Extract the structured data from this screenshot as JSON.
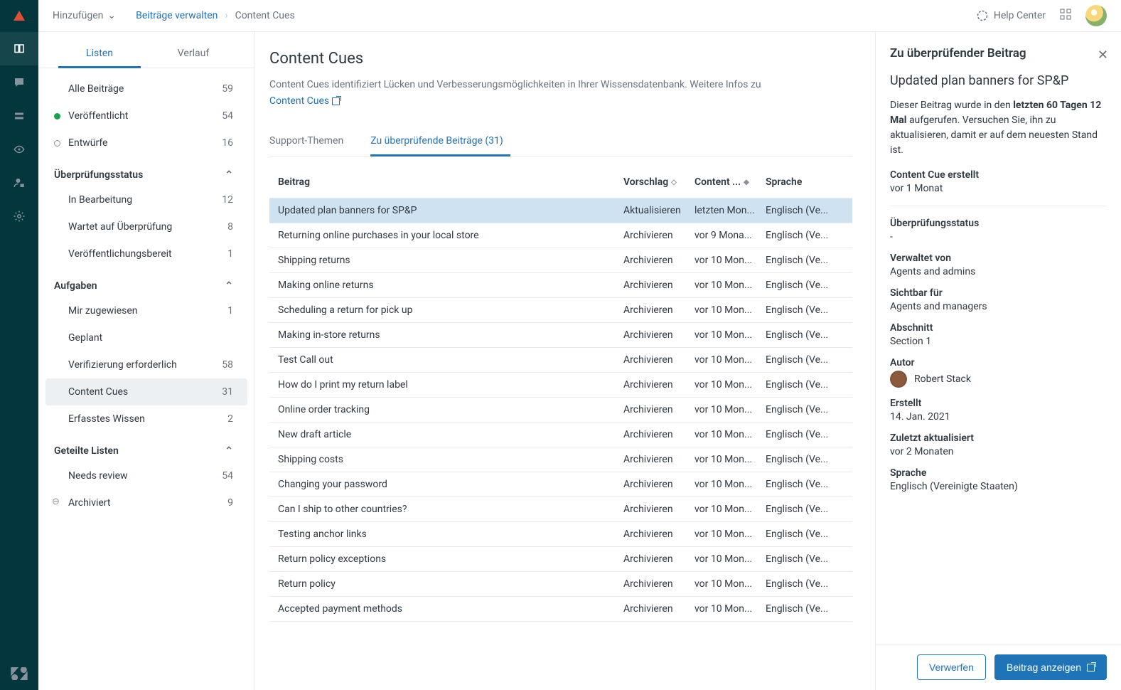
{
  "topbar": {
    "add_label": "Hinzufügen",
    "crumb_link": "Beiträge verwalten",
    "crumb_current": "Content Cues",
    "help_label": "Help Center"
  },
  "sidebar": {
    "tabs": {
      "listen": "Listen",
      "verlauf": "Verlauf"
    },
    "primary": [
      {
        "label": "Alle Beiträge",
        "count": "59",
        "dot": ""
      },
      {
        "label": "Veröffentlicht",
        "count": "54",
        "dot": "green"
      },
      {
        "label": "Entwürfe",
        "count": "16",
        "dot": "outline"
      }
    ],
    "groups": [
      {
        "heading": "Überprüfungsstatus",
        "items": [
          {
            "label": "In Bearbeitung",
            "count": "12"
          },
          {
            "label": "Wartet auf Überprüfung",
            "count": "8"
          },
          {
            "label": "Veröffentlichungsbereit",
            "count": "1"
          }
        ]
      },
      {
        "heading": "Aufgaben",
        "items": [
          {
            "label": "Mir zugewiesen",
            "count": "1"
          },
          {
            "label": "Geplant",
            "count": ""
          },
          {
            "label": "Verifizierung erforderlich",
            "count": "58"
          },
          {
            "label": "Content Cues",
            "count": "31",
            "selected": true
          },
          {
            "label": "Erfasstes Wissen",
            "count": "2"
          }
        ]
      },
      {
        "heading": "Geteilte Listen",
        "items": [
          {
            "label": "Needs review",
            "count": "54"
          },
          {
            "label": "Archiviert",
            "count": "9",
            "dot": "archive"
          }
        ]
      }
    ]
  },
  "main": {
    "title": "Content Cues",
    "desc_prefix": "Content Cues identifiziert Lücken und Verbesserungsmöglichkeiten in Ihrer Wissensdatenbank. Weitere Infos zu",
    "desc_link": "Content Cues",
    "tabs": {
      "support": "Support-Themen",
      "review": "Zu überprüfende Beiträge (31)"
    },
    "columns": {
      "beitrag": "Beitrag",
      "vorschlag": "Vorschlag",
      "content": "Content ...",
      "sprache": "Sprache"
    },
    "rows": [
      {
        "t": "Updated plan banners for SP&P",
        "s": "Aktualisieren",
        "c": "letzten Mon...",
        "l": "Englisch (Ve...",
        "sel": true
      },
      {
        "t": "Returning online purchases in your local store",
        "s": "Archivieren",
        "c": "vor 9 Mona...",
        "l": "Englisch (Ve..."
      },
      {
        "t": "Shipping returns",
        "s": "Archivieren",
        "c": "vor 10 Mon...",
        "l": "Englisch (Ve..."
      },
      {
        "t": "Making online returns",
        "s": "Archivieren",
        "c": "vor 10 Mon...",
        "l": "Englisch (Ve..."
      },
      {
        "t": "Scheduling a return for pick up",
        "s": "Archivieren",
        "c": "vor 10 Mon...",
        "l": "Englisch (Ve..."
      },
      {
        "t": "Making in-store returns",
        "s": "Archivieren",
        "c": "vor 10 Mon...",
        "l": "Englisch (Ve..."
      },
      {
        "t": "Test Call out",
        "s": "Archivieren",
        "c": "vor 10 Mon...",
        "l": "Englisch (Ve..."
      },
      {
        "t": "How do I print my return label",
        "s": "Archivieren",
        "c": "vor 10 Mon...",
        "l": "Englisch (Ve..."
      },
      {
        "t": "Online order tracking",
        "s": "Archivieren",
        "c": "vor 10 Mon...",
        "l": "Englisch (Ve..."
      },
      {
        "t": "New draft article",
        "s": "Archivieren",
        "c": "vor 10 Mon...",
        "l": "Englisch (Ve..."
      },
      {
        "t": "Shipping costs",
        "s": "Archivieren",
        "c": "vor 10 Mon...",
        "l": "Englisch (Ve..."
      },
      {
        "t": "Changing your password",
        "s": "Archivieren",
        "c": "vor 10 Mon...",
        "l": "Englisch (Ve..."
      },
      {
        "t": "Can I ship to other countries?",
        "s": "Archivieren",
        "c": "vor 10 Mon...",
        "l": "Englisch (Ve..."
      },
      {
        "t": "Testing anchor links",
        "s": "Archivieren",
        "c": "vor 10 Mon...",
        "l": "Englisch (Ve..."
      },
      {
        "t": "Return policy exceptions",
        "s": "Archivieren",
        "c": "vor 10 Mon...",
        "l": "Englisch (Ve..."
      },
      {
        "t": "Return policy",
        "s": "Archivieren",
        "c": "vor 10 Mon...",
        "l": "Englisch (Ve..."
      },
      {
        "t": "Accepted payment methods",
        "s": "Archivieren",
        "c": "vor 10 Mon...",
        "l": "Englisch (Ve..."
      }
    ]
  },
  "detail": {
    "heading": "Zu überprüfender Beitrag",
    "title": "Updated plan banners for SP&P",
    "para_pre": "Dieser Beitrag wurde in den ",
    "para_bold": "letzten 60 Tagen 12 Mal",
    "para_post": " aufgerufen. Versuchen Sie, ihn zu aktualisieren, damit er auf dem neuesten Stand ist.",
    "cue_created_k": "Content Cue erstellt",
    "cue_created_v": "vor 1 Monat",
    "status_k": "Überprüfungsstatus",
    "status_v": "-",
    "managed_k": "Verwaltet von",
    "managed_v": "Agents and admins",
    "visible_k": "Sichtbar für",
    "visible_v": "Agents and managers",
    "section_k": "Abschnitt",
    "section_v": "Section 1",
    "author_k": "Autor",
    "author_v": "Robert Stack",
    "created_k": "Erstellt",
    "created_v": "14. Jan. 2021",
    "updated_k": "Zuletzt aktualisiert",
    "updated_v": "vor 2 Monaten",
    "lang_k": "Sprache",
    "lang_v": "Englisch (Vereinigte Staaten)",
    "discard": "Verwerfen",
    "show": "Beitrag anzeigen"
  }
}
